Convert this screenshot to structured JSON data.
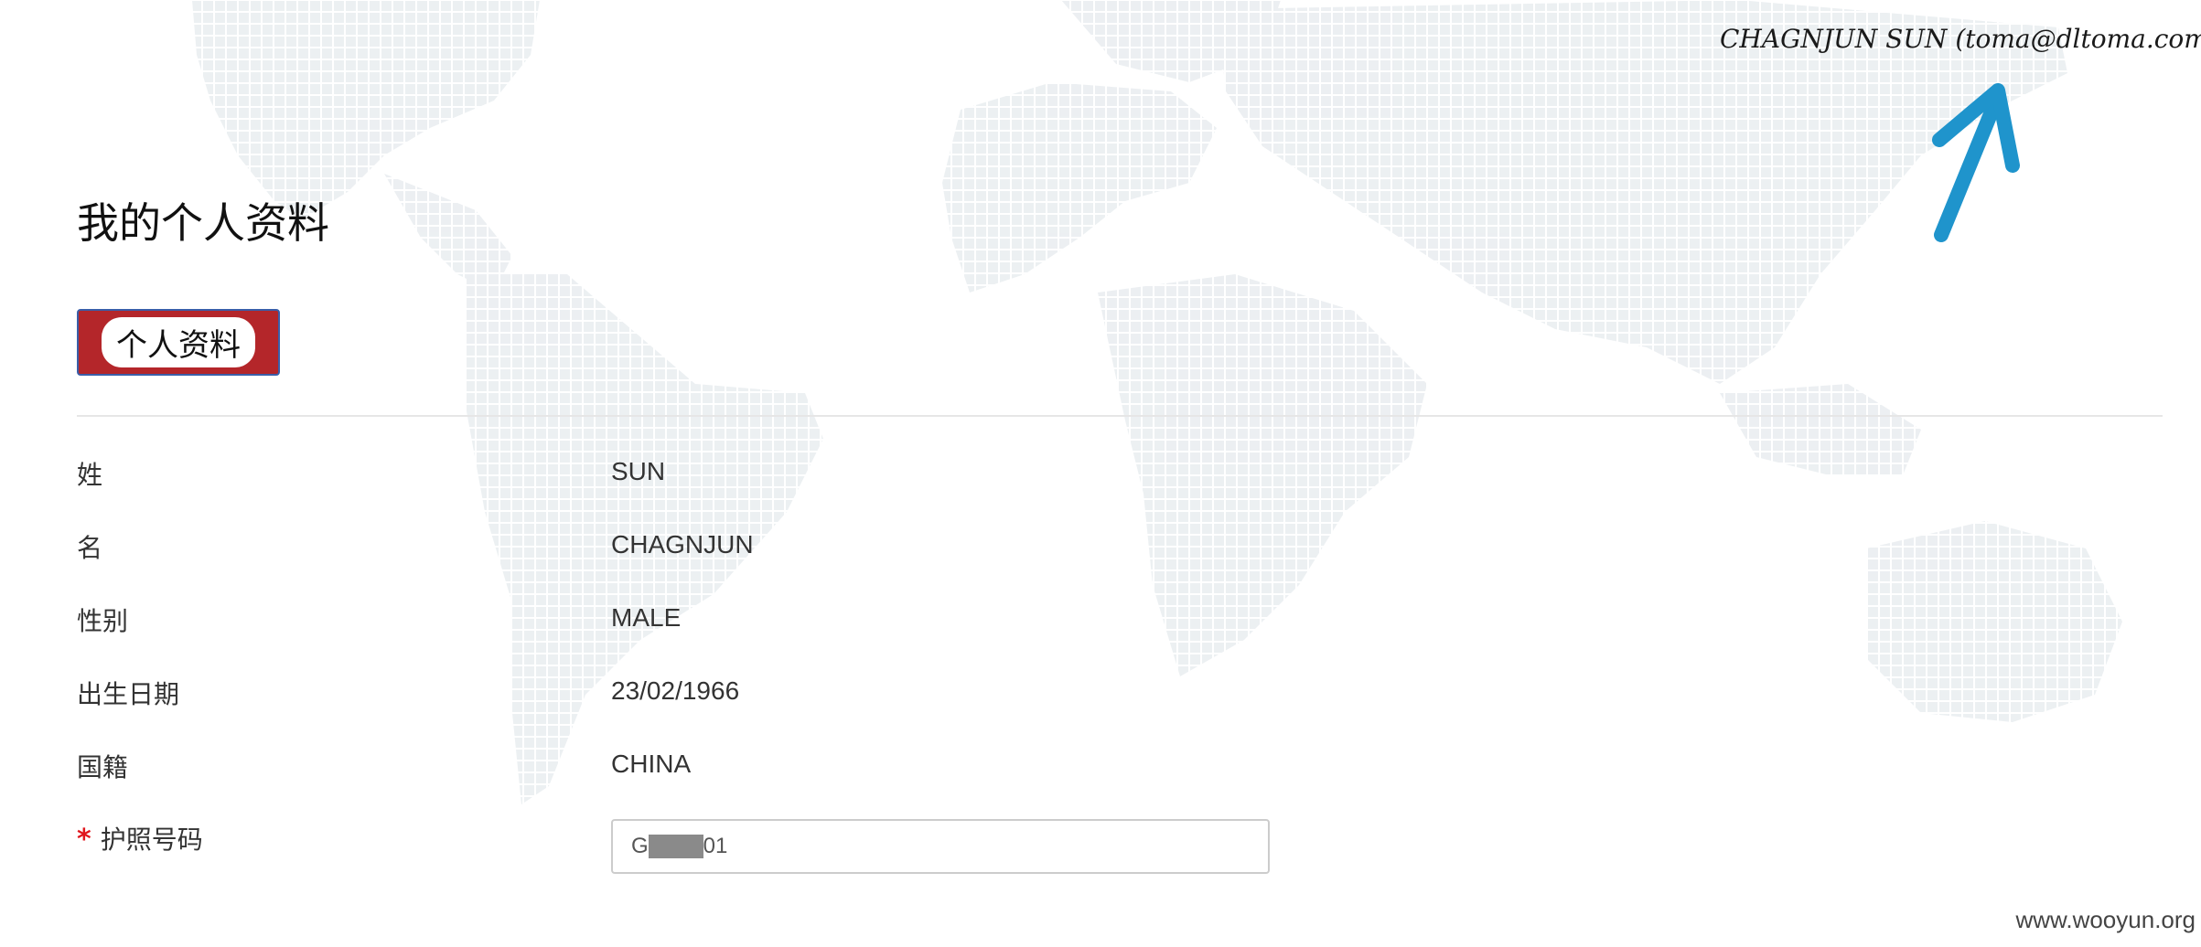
{
  "header": {
    "user_info": "CHAGNJUN SUN (toma@dltoma.com)"
  },
  "page": {
    "title": "我的个人资料",
    "tab_label": "个人资料"
  },
  "profile": {
    "fields": [
      {
        "label": "姓",
        "value": "SUN"
      },
      {
        "label": "名",
        "value": "CHAGNJUN"
      },
      {
        "label": "性别",
        "value": "MALE"
      },
      {
        "label": "出生日期",
        "value": "23/02/1966"
      },
      {
        "label": "国籍",
        "value": "CHINA"
      }
    ],
    "passport": {
      "required_mark": "*",
      "label": "护照号码",
      "value_prefix": "G",
      "value_suffix": "01"
    }
  },
  "watermark": "www.wooyun.org",
  "colors": {
    "tab_background": "#b4262a",
    "tab_border": "#3a5ea8",
    "arrow": "#1f94cc",
    "required": "#e0161d",
    "map_dots": "#e9edf0"
  },
  "icons": {
    "annotation_arrow": "arrow-up-right-icon"
  }
}
